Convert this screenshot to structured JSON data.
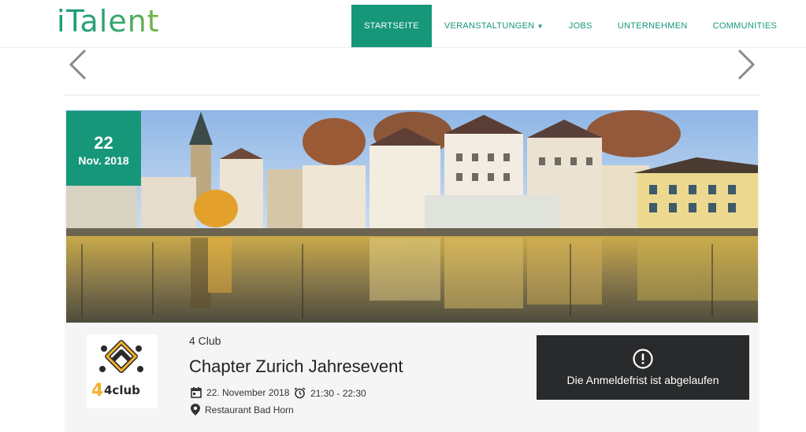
{
  "header": {
    "logo_i": "i",
    "logo_rest": "Talent",
    "nav": [
      {
        "label": "STARTSEITE",
        "active": true
      },
      {
        "label": "VERANSTALTUNGEN",
        "has_dropdown": true
      },
      {
        "label": "JOBS"
      },
      {
        "label": "UNTERNEHMEN"
      },
      {
        "label": "COMMUNITIES"
      }
    ]
  },
  "event": {
    "day": "22",
    "month_year": "Nov. 2018",
    "organizer": "4 Club",
    "title": "Chapter Zurich Jahresevent",
    "date": "22. November 2018",
    "time": "21:30 - 22:30",
    "location": "Restaurant Bad Horn",
    "registration_status": "Die Anmeldefrist ist abgelaufen",
    "org_logo_text": "4club"
  },
  "colors": {
    "brand_green": "#16977a",
    "dark_box": "#282a2c"
  }
}
